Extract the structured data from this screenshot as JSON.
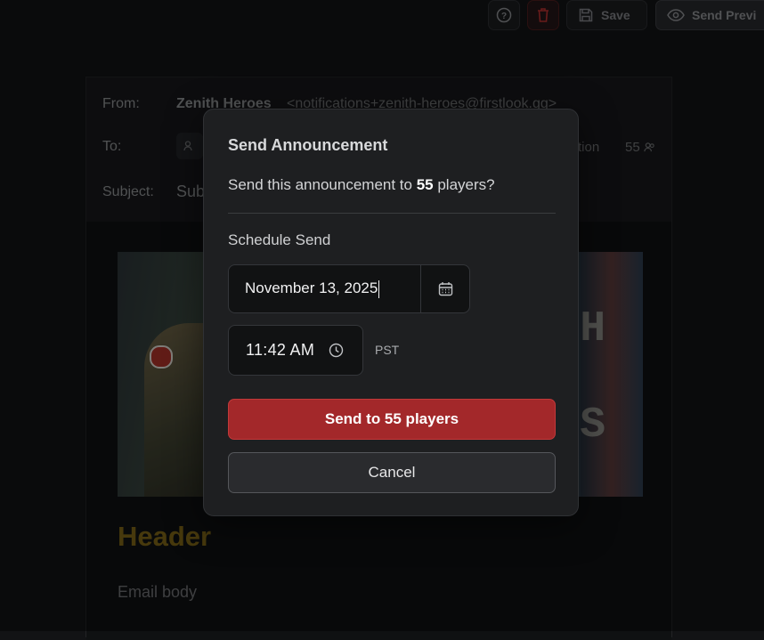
{
  "toolbar": {
    "save_label": "Save",
    "send_preview_label": "Send Previ",
    "help_icon": "help-circle-icon",
    "delete_icon": "trash-icon",
    "save_icon": "floppy-disk-icon",
    "preview_icon": "eye-icon"
  },
  "email": {
    "from_label": "From:",
    "from_name": "Zenith Heroes",
    "from_address": "<notifications+zenith-heroes@firstlook.gg>",
    "to_label": "To:",
    "to_segment_partial": "tion",
    "to_count": "55",
    "subject_label": "Subject:",
    "subject_partial": "Sub",
    "header_text": "Header",
    "body_text": "Email body",
    "header_color": "#7a6317"
  },
  "modal": {
    "title": "Send Announcement",
    "desc_prefix": "Send this announcement to ",
    "desc_count": "55",
    "desc_suffix": " players?",
    "schedule_label": "Schedule Send",
    "date_value": "November 13, 2025",
    "time_value": "11:42 AM",
    "timezone": "PST",
    "send_button": "Send to 55 players",
    "cancel_button": "Cancel",
    "accent_color": "#a3282a"
  }
}
